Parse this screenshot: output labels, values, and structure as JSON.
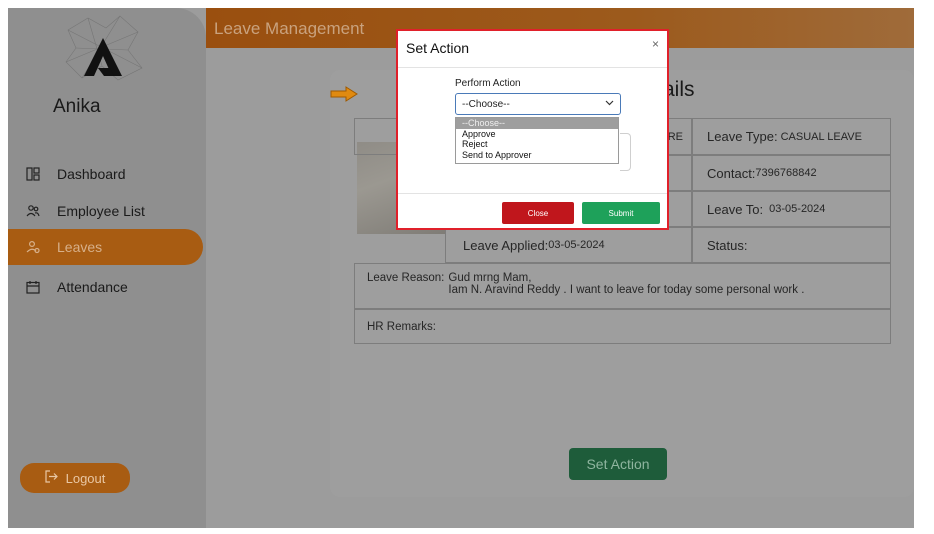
{
  "sidebar": {
    "brand": "Anika",
    "items": [
      {
        "label": "Dashboard",
        "icon": "dashboard-icon"
      },
      {
        "label": "Employee List",
        "icon": "users-icon"
      },
      {
        "label": "Leaves",
        "icon": "leaves-icon",
        "active": true
      },
      {
        "label": "Attendance",
        "icon": "calendar-icon"
      }
    ],
    "logout_label": "Logout"
  },
  "header": {
    "title": "Leave Management"
  },
  "card": {
    "title_fragment": "ails",
    "rows": {
      "emp_fragment": "RE",
      "leave_type_label": "Leave Type:",
      "leave_type_value": "CASUAL LEAVE",
      "contact_label": "Contact:",
      "contact_value": "7396768842",
      "leave_to_label": "Leave To:",
      "leave_to_value": "03-05-2024",
      "leave_applied_label": "Leave Applied:",
      "leave_applied_value": "03-05-2024",
      "status_label": "Status:",
      "status_value": "",
      "reason_label": "Leave Reason:",
      "reason_line1": "Gud mrng Mam,",
      "reason_line2": "Iam N. Aravind Reddy . I want to leave for today some personal work .",
      "hr_remarks_label": "HR Remarks:"
    },
    "set_action_label": "Set Action"
  },
  "modal": {
    "title": "Set Action",
    "close_glyph": "×",
    "perform_label": "Perform Action",
    "select_value": "--Choose--",
    "options": [
      "--Choose--",
      "Approve",
      "Reject",
      "Send to Approver"
    ],
    "close_label": "Close",
    "submit_label": "Submit"
  },
  "colors": {
    "accent": "#a85c12",
    "danger": "#c0161c",
    "success": "#1ea15a",
    "modal_border": "#e0202a"
  }
}
